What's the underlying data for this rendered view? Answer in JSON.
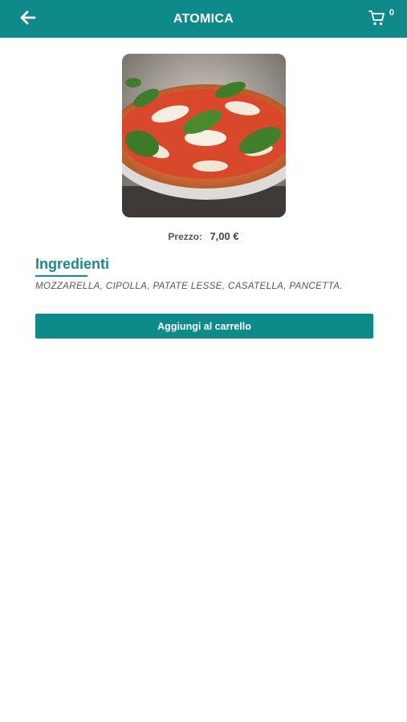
{
  "header": {
    "title": "ATOMICA",
    "back_icon": "arrow-left-icon",
    "cart_icon": "shopping-cart-icon",
    "cart_count": "0",
    "background_color": "#0e8a8a"
  },
  "product": {
    "image": "pizza-image",
    "price_label": "Prezzo:",
    "price_value": "7,00 €"
  },
  "ingredients": {
    "title": "Ingredienti",
    "text": "MOZZARELLA, CIPOLLA, PATATE LESSE, CASATELLA, PANCETTA."
  },
  "actions": {
    "add_to_cart_label": "Aggiungi al carrello"
  }
}
